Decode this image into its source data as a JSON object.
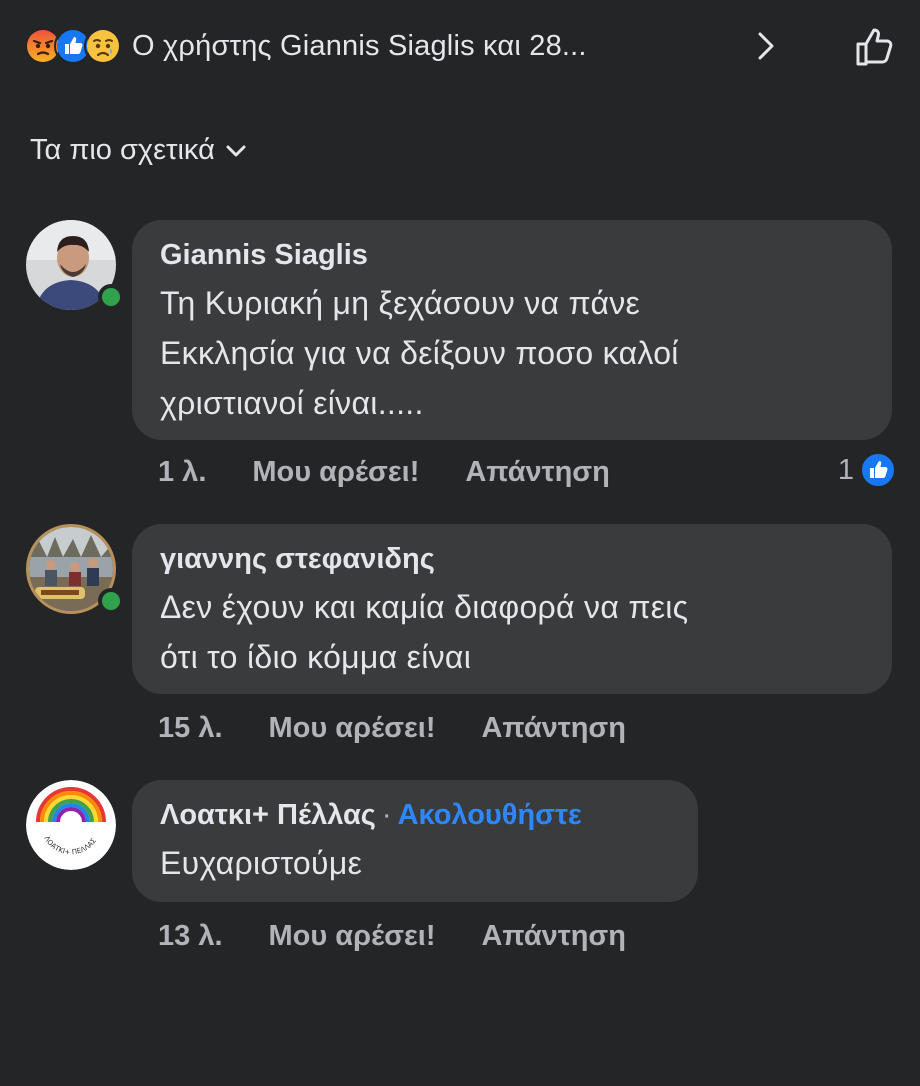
{
  "reactions": {
    "icons": [
      "angry-emoji",
      "like-thumb",
      "sad-emoji"
    ],
    "summary": "Ο χρήστης Giannis Siaglis και 28...",
    "chevron": "chevron-right-icon",
    "like_icon": "thumb-up-outline-icon"
  },
  "sort": {
    "label": "Τα πιο σχετικά",
    "icon": "chevron-down-icon"
  },
  "comments": [
    {
      "author": "Giannis Siaglis",
      "text_lines": [
        "Τη Κυριακή μη ξεχάσουν να πάνε",
        "Εκκλησία για να δείξουν ποσο καλοί",
        "χριστιανοί είναι....."
      ],
      "time": "1 λ.",
      "like_label": "Μου αρέσει!",
      "reply_label": "Απάντηση",
      "reaction_count": "1",
      "online": true
    },
    {
      "author": "γιαννης στεφανιδης",
      "text_lines": [
        "Δεν έχουν και καμία διαφορά να πεις",
        "ότι το ίδιο κόμμα είναι"
      ],
      "time": "15 λ.",
      "like_label": "Μου αρέσει!",
      "reply_label": "Απάντηση",
      "online": true
    },
    {
      "author": "Λοατκι+ Πέλλας",
      "follow_separator": "·",
      "follow_label": "Ακολουθήστε",
      "text_lines": [
        "Ευχαριστούμε"
      ],
      "time": "13 λ.",
      "like_label": "Μου αρέσει!",
      "reply_label": "Απάντηση",
      "avatar_text": "ΛΟΑΤΚΙ+ ΠΕΛΛΑΣ"
    }
  ],
  "colors": {
    "background": "#242526",
    "bubble": "#3a3b3c",
    "text": "#e4e6eb",
    "secondary_text": "#b0b3b8",
    "link_blue": "#2d88ff",
    "online_green": "#31a24c",
    "like_blue": "#1877f2"
  }
}
